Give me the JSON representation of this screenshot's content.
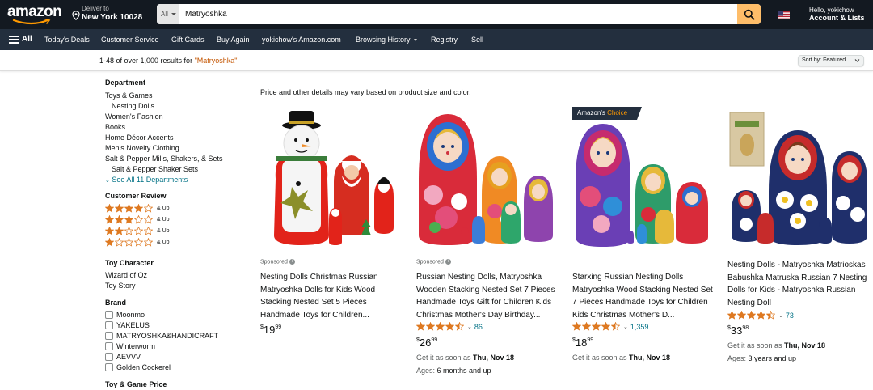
{
  "header": {
    "logo": "amazon",
    "deliver_line1": "Deliver to",
    "deliver_line2": "New York 10028",
    "search_category": "All",
    "search_value": "Matryoshka",
    "account_line1": "Hello, yokichow",
    "account_line2": "Account & Lists"
  },
  "nav": {
    "all": "All",
    "items": [
      "Today's Deals",
      "Customer Service",
      "Gift Cards",
      "Buy Again",
      "yokichow's Amazon.com",
      "Browsing History",
      "Registry",
      "Sell"
    ]
  },
  "results": {
    "count_prefix": "1-48 of over 1,000 results for ",
    "query": "\"Matryoshka\"",
    "sort_label": "Sort by:  Featured"
  },
  "sidebar": {
    "department_heading": "Department",
    "departments": [
      "Toys & Games",
      "Nesting Dolls",
      "Women's Fashion",
      "Books",
      "Home Décor Accents",
      "Men's Novelty Clothing",
      "Salt & Pepper Mills, Shakers, & Sets",
      "Salt & Pepper Shaker Sets"
    ],
    "see_all": "See All 11 Departments",
    "review_heading": "Customer Review",
    "and_up": "& Up",
    "character_heading": "Toy Character",
    "characters": [
      "Wizard of Oz",
      "Toy Story"
    ],
    "brand_heading": "Brand",
    "brands": [
      "Moonmo",
      "YAKELUS",
      "MATRYOSHKA&HANDICRAFT",
      "Winterworm",
      "AEVVV",
      "Golden Cockerel"
    ],
    "price_heading": "Toy & Game Price"
  },
  "main": {
    "disclaimer": "Price and other details may vary based on product size and color."
  },
  "products": [
    {
      "sponsored": "Sponsored",
      "badge": "",
      "title": "Nesting Dolls Christmas Russian Matryoshka Dolls for Kids Wood Stacking Nested Set 5 Pieces Handmade Toys for Children...",
      "rating_stars": 0,
      "rating_count": "",
      "price_whole": "19",
      "price_frac": "99",
      "delivery_prefix": "",
      "delivery_date": "",
      "ages_prefix": "",
      "ages_value": ""
    },
    {
      "sponsored": "Sponsored",
      "badge": "",
      "title": "Russian Nesting Dolls, Matryoshka Wooden Stacking Nested Set 7 Pieces Handmade Toys Gift for Children Kids Christmas Mother's Day Birthday...",
      "rating_stars": 4.5,
      "rating_count": "86",
      "price_whole": "26",
      "price_frac": "99",
      "delivery_prefix": "Get it as soon as ",
      "delivery_date": "Thu, Nov 18",
      "ages_prefix": "Ages: ",
      "ages_value": "6 months and up"
    },
    {
      "sponsored": "",
      "badge_main": "Amazon's ",
      "badge_choice": "Choice",
      "title": "Starxing Russian Nesting Dolls Matryoshka Wood Stacking Nested Set 7 Pieces Handmade Toys for Children Kids Christmas Mother's D...",
      "rating_stars": 4.5,
      "rating_count": "1,359",
      "price_whole": "18",
      "price_frac": "99",
      "delivery_prefix": "Get it as soon as ",
      "delivery_date": "Thu, Nov 18",
      "ages_prefix": "",
      "ages_value": ""
    },
    {
      "sponsored": "",
      "badge": "",
      "title": "Nesting Dolls - Matryoshka Matrioskas Babushka Matruska Russian 7 Nesting Dolls for Kids - Matryoshka Russian Nesting Doll",
      "rating_stars": 4.5,
      "rating_count": "73",
      "price_whole": "33",
      "price_frac": "98",
      "delivery_prefix": "Get it as soon as ",
      "delivery_date": "Thu, Nov 18",
      "ages_prefix": "Ages: ",
      "ages_value": "3 years and up"
    }
  ],
  "colors": {
    "header_bg": "#131921",
    "nav_bg": "#232f3e",
    "search_button": "#febd69",
    "link": "#007185",
    "star": "#de7921",
    "query": "#c45500"
  },
  "icons": [
    "location-pin-icon",
    "search-icon",
    "us-flag-icon",
    "hamburger-icon",
    "info-icon",
    "star-icon",
    "chevron-down-icon"
  ]
}
